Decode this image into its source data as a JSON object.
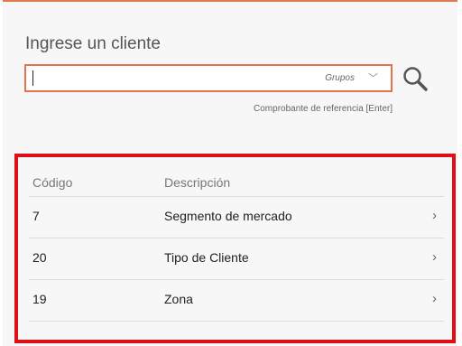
{
  "search": {
    "heading": "Ingrese un cliente",
    "value": "",
    "group_label": "Grupos",
    "reference_link": "Comprobante de referencia [Enter]"
  },
  "table": {
    "headers": {
      "code": "Código",
      "description": "Descripción"
    },
    "rows": [
      {
        "code": "7",
        "description": "Segmento de mercado"
      },
      {
        "code": "20",
        "description": "Tipo de Cliente"
      },
      {
        "code": "19",
        "description": "Zona"
      }
    ]
  },
  "colors": {
    "accent": "#e2734a",
    "highlight_border": "#e10d17"
  }
}
